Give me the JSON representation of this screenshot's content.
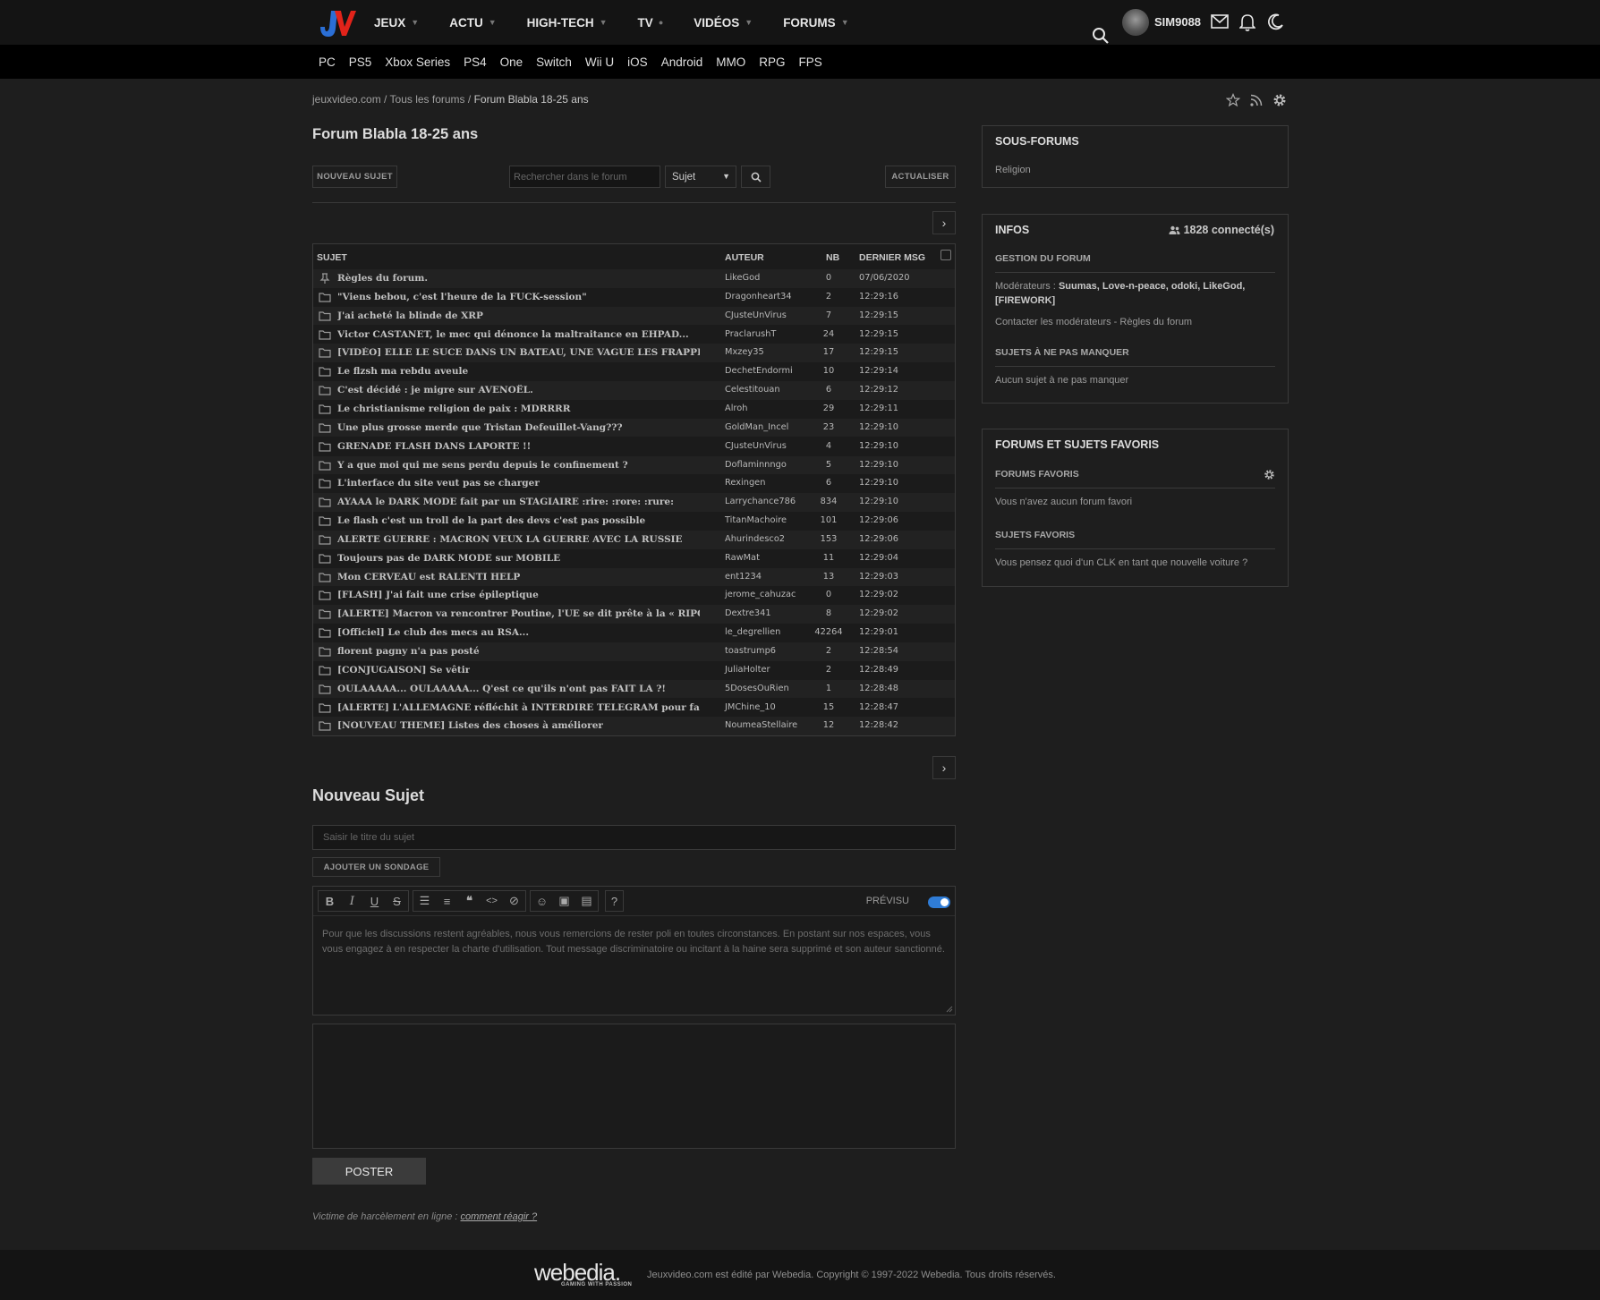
{
  "header": {
    "nav": [
      {
        "label": "JEUX"
      },
      {
        "label": "ACTU"
      },
      {
        "label": "HIGH-TECH"
      },
      {
        "label": "TV"
      },
      {
        "label": "VIDÉOS"
      },
      {
        "label": "FORUMS"
      }
    ],
    "username": "SIM9088",
    "platforms": [
      "PC",
      "PS5",
      "Xbox Series",
      "PS4",
      "One",
      "Switch",
      "Wii U",
      "iOS",
      "Android",
      "MMO",
      "RPG",
      "FPS"
    ]
  },
  "breadcrumb": {
    "home": "jeuxvideo.com",
    "forums": "Tous les forums",
    "current": "Forum Blabla 18-25 ans"
  },
  "page_title": "Forum Blabla 18-25 ans",
  "toolbar": {
    "new_topic": "NOUVEAU SUJET",
    "search_placeholder": "Rechercher dans le forum",
    "search_scope": "Sujet",
    "refresh": "ACTUALISER"
  },
  "table": {
    "headers": {
      "subject": "SUJET",
      "author": "AUTEUR",
      "count": "NB",
      "last": "DERNIER MSG"
    },
    "rows": [
      {
        "icon": "pin-icon",
        "subject": "Règles du forum.",
        "author": "LikeGod",
        "nb": "0",
        "last": "07/06/2020"
      },
      {
        "icon": "folder-icon",
        "subject": "\"Viens bebou, c'est l'heure de la FUCK-session\"",
        "author": "Dragonheart34",
        "nb": "2",
        "last": "12:29:16"
      },
      {
        "icon": "folder-icon",
        "subject": "J'ai acheté la blinde de XRP",
        "author": "CJusteUnVirus",
        "nb": "7",
        "last": "12:29:15"
      },
      {
        "icon": "folder-icon",
        "subject": "Victor CASTANET, le mec qui dénonce la maltraitance en EHPAD...",
        "author": "PraclarushT",
        "nb": "24",
        "last": "12:29:15"
      },
      {
        "icon": "folder-icon",
        "subject": "[VIDÉO] ELLE LE SUCE DANS UN BATEAU, UNE VAGUE LES FRAPPES, ELLE SE...",
        "author": "Mxzey35",
        "nb": "17",
        "last": "12:29:15"
      },
      {
        "icon": "folder-icon",
        "subject": "Le flzsh ma rebdu aveule",
        "author": "DechetEndormi",
        "nb": "10",
        "last": "12:29:14"
      },
      {
        "icon": "folder-icon",
        "subject": "C'est décidé : je migre sur AVENOËL.",
        "author": "Celestitouan",
        "nb": "6",
        "last": "12:29:12"
      },
      {
        "icon": "folder-icon",
        "subject": "Le christianisme religion de paix : MDRRRR",
        "author": "Alroh",
        "nb": "29",
        "last": "12:29:11"
      },
      {
        "icon": "folder-icon",
        "subject": "Une plus grosse merde que Tristan Defeuillet-Vang???",
        "author": "GoldMan_Incel",
        "nb": "23",
        "last": "12:29:10"
      },
      {
        "icon": "folder-icon",
        "subject": "GRENADE FLASH DANS LAPORTE !!",
        "author": "CJusteUnVirus",
        "nb": "4",
        "last": "12:29:10"
      },
      {
        "icon": "folder-icon",
        "subject": "Y a que moi qui me sens perdu depuis le confinement ?",
        "author": "Doflaminnngo",
        "nb": "5",
        "last": "12:29:10"
      },
      {
        "icon": "folder-icon",
        "subject": "L'interface du site veut pas se charger",
        "author": "Rexingen",
        "nb": "6",
        "last": "12:29:10"
      },
      {
        "icon": "folder-icon",
        "subject": "AYAAA le DARK MODE fait par un STAGIAIRE :rire: :rore: :rure:",
        "author": "Larrychance786",
        "nb": "834",
        "last": "12:29:10"
      },
      {
        "icon": "folder-icon",
        "subject": "Le flash c'est un troll de la part des devs c'est pas possible",
        "author": "TitanMachoire",
        "nb": "101",
        "last": "12:29:06"
      },
      {
        "icon": "folder-icon",
        "subject": "ALERTE GUERRE : MACRON VEUX LA GUERRE AVEC LA RUSSIE",
        "author": "Ahurindesco2",
        "nb": "153",
        "last": "12:29:06"
      },
      {
        "icon": "folder-icon",
        "subject": "Toujours pas de DARK MODE sur MOBILE",
        "author": "RawMat",
        "nb": "11",
        "last": "12:29:04"
      },
      {
        "icon": "folder-icon",
        "subject": "Mon CERVEAU est RALENTI HELP",
        "author": "ent1234",
        "nb": "13",
        "last": "12:29:03"
      },
      {
        "icon": "folder-icon",
        "subject": "[FLASH] J'ai fait une crise épileptique",
        "author": "jerome_cahuzac",
        "nb": "0",
        "last": "12:29:02"
      },
      {
        "icon": "folder-icon",
        "subject": "[ALERTE] Macron va rencontrer Poutine, l'UE se dit prête à la « RIPOSTE »",
        "author": "Dextre341",
        "nb": "8",
        "last": "12:29:02"
      },
      {
        "icon": "folder-icon",
        "subject": "[Officiel] Le club des mecs au RSA...",
        "author": "le_degrellien",
        "nb": "42264",
        "last": "12:29:01"
      },
      {
        "icon": "folder-icon",
        "subject": "florent pagny n'a pas posté",
        "author": "toastrump6",
        "nb": "2",
        "last": "12:28:54"
      },
      {
        "icon": "folder-icon",
        "subject": "[CONJUGAISON] Se vêtir",
        "author": "JuliaHolter",
        "nb": "2",
        "last": "12:28:49"
      },
      {
        "icon": "folder-icon",
        "subject": "OULAAAAA... OULAAAAA... Q'est ce qu'ils n'ont pas FAIT LA ?!",
        "author": "5DosesOuRien",
        "nb": "1",
        "last": "12:28:48"
      },
      {
        "icon": "folder-icon",
        "subject": "[ALERTE] L'ALLEMAGNE réfléchit à INTERDIRE TELEGRAM pour faire face au ...",
        "author": "JMChine_10",
        "nb": "15",
        "last": "12:28:47"
      },
      {
        "icon": "folder-icon",
        "subject": "[NOUVEAU THEME] Listes des choses à améliorer",
        "author": "NoumeaStellaire",
        "nb": "12",
        "last": "12:28:42"
      }
    ]
  },
  "new_topic": {
    "title": "Nouveau Sujet",
    "title_placeholder": "Saisir le titre du sujet",
    "add_poll": "AJOUTER UN SONDAGE",
    "preview_label": "PRÉVISU",
    "editor_placeholder": "Pour que les discussions restent agréables, nous vous remercions de rester poli en toutes circonstances. En postant sur nos espaces, vous vous engagez à en respecter la charte d'utilisation. Tout message discriminatoire ou incitant à la haine sera supprimé et son auteur sanctionné.",
    "post": "POSTER",
    "harass_text": "Victime de harcèlement en ligne :",
    "harass_link": "comment réagir ?"
  },
  "sidebar": {
    "subforums": {
      "title": "SOUS-FORUMS",
      "items": [
        "Religion"
      ]
    },
    "infos": {
      "title": "INFOS",
      "connected": "1828 connecté(s)",
      "management_title": "GESTION DU FORUM",
      "moderators_label": "Modérateurs :",
      "moderators": "Suumas, Love-n-peace, odoki, LikeGod,",
      "moderators_2": "[FIREWORK]",
      "contact": "Contacter les modérateurs - Règles du forum",
      "must_see_title": "SUJETS À NE PAS MANQUER",
      "must_see_text": "Aucun sujet à ne pas manquer"
    },
    "favorites": {
      "title": "FORUMS ET SUJETS FAVORIS",
      "forums_title": "FORUMS FAVORIS",
      "forums_text": "Vous n'avez aucun forum favori",
      "topics_title": "SUJETS FAVORIS",
      "topics_text": "Vous pensez quoi d'un CLK en tant que nouvelle voiture ?"
    }
  },
  "footer": {
    "brand": "webedia.",
    "brand_sub": "GAMING WITH PASSION",
    "copyright": "Jeuxvideo.com est édité par Webedia. Copyright © 1997-2022 Webedia. Tous droits réservés."
  },
  "colors": {
    "logo_red": "#e2231a",
    "logo_blue": "#2b6fd6",
    "toggle": "#2f7cd6"
  }
}
